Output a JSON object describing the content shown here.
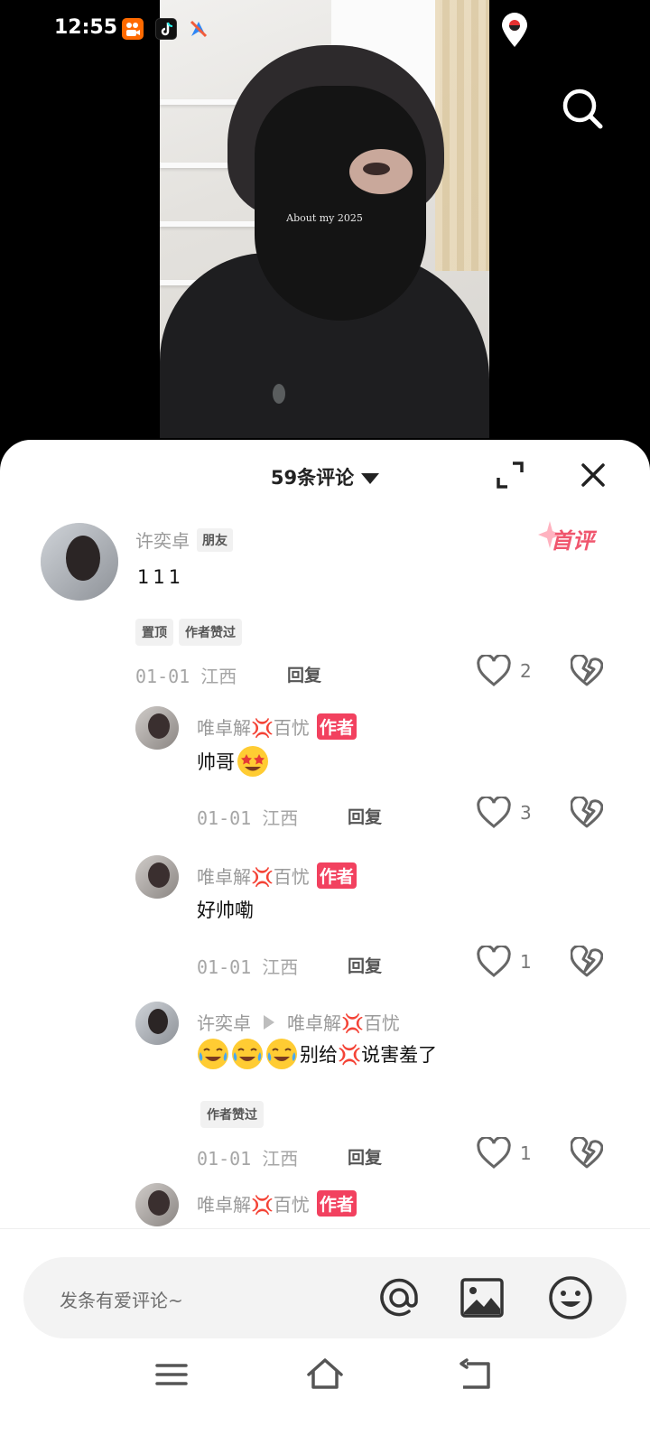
{
  "status_bar": {
    "time": "12:55",
    "apps": [
      "kuaishou-icon",
      "tiktok-icon",
      "explore-icon"
    ],
    "location_icon": "location-pin-icon"
  },
  "video": {
    "caption": "About my 2025",
    "search_icon": "search-icon"
  },
  "comments_sheet": {
    "title": "59条评论",
    "expand_icon": "expand-icon",
    "close_icon": "close-icon",
    "comments": [
      {
        "author": "许奕卓",
        "friend_tag": "朋友",
        "first_badge": "首评",
        "text": "111",
        "pills": [
          "置顶",
          "作者赞过"
        ],
        "meta": "01-01 江西",
        "reply_label": "回复",
        "likes": "2"
      },
      {
        "author": "唯卓解💢百忧",
        "author_tag": "作者",
        "text": "帅哥",
        "emoji": [
          "star-struck-emoji"
        ],
        "meta": "01-01 江西",
        "reply_label": "回复",
        "likes": "3"
      },
      {
        "author": "唯卓解💢百忧",
        "author_tag": "作者",
        "text": "好帅嘞",
        "meta": "01-01 江西",
        "reply_label": "回复",
        "likes": "1"
      },
      {
        "author": "许奕卓",
        "reply_to": "唯卓解💢百忧",
        "emoji": [
          "laughing-crying-emoji",
          "laughing-crying-emoji",
          "laughing-crying-emoji"
        ],
        "text": "别给💢说害羞了",
        "pills": [
          "作者赞过"
        ],
        "meta": "01-01 江西",
        "reply_label": "回复",
        "likes": "1"
      },
      {
        "author": "唯卓解💢百忧",
        "author_tag": "作者"
      }
    ]
  },
  "input_bar": {
    "placeholder": "发条有爱评论~",
    "icons": [
      "at-icon",
      "image-icon",
      "emoji-icon"
    ]
  },
  "nav_bar": {
    "icons": [
      "menu-icon",
      "home-icon",
      "back-icon"
    ]
  },
  "colors": {
    "author_tag": "#f2415f",
    "first_badge": "#f0566e",
    "sheet_bg": "#ffffff",
    "input_bg": "#f3f3f3"
  }
}
